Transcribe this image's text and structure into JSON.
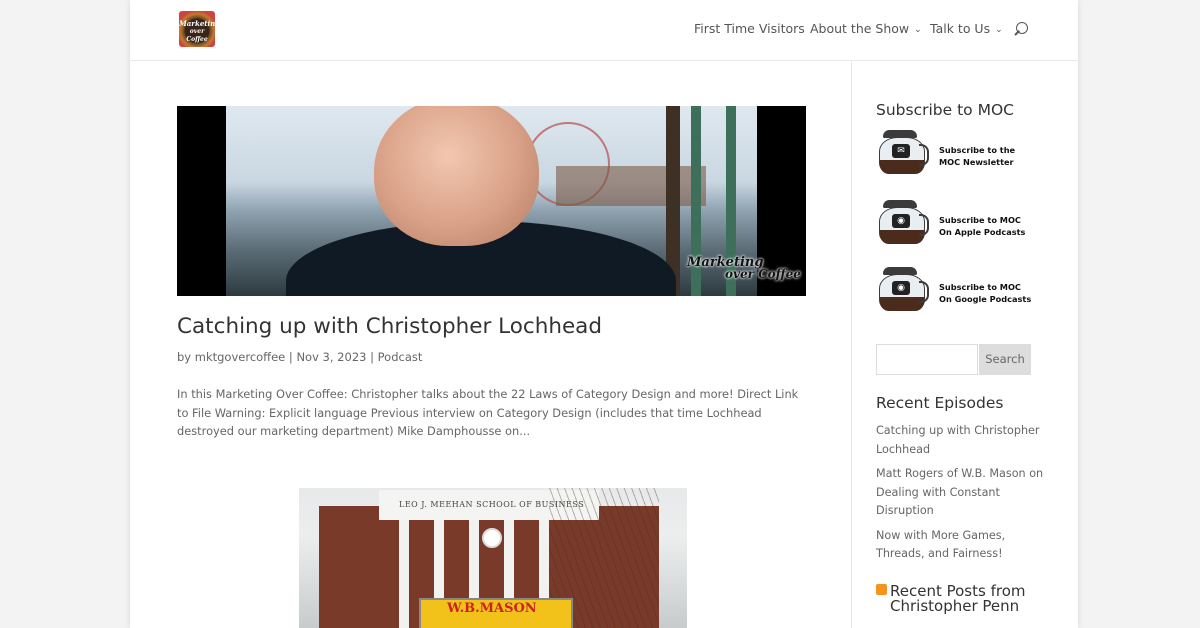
{
  "header": {
    "logo_text_1": "Marketing",
    "logo_text_2": "over Coffee",
    "nav": [
      {
        "label": "First Time Visitors"
      },
      {
        "label": "About the Show"
      },
      {
        "label": "Talk to Us"
      }
    ],
    "chevron": "⌄"
  },
  "post": {
    "hero_brand_1": "Marketing",
    "hero_brand_2": "over Coffee",
    "title": "Catching up with Christopher Lochhead",
    "meta_by": "by",
    "author": "mktgovercoffee",
    "sep": "|",
    "date": "Nov 3, 2023",
    "category": "Podcast",
    "excerpt": "In this Marketing Over Coffee: Christopher talks about the 22 Laws of Category Design and more! Direct Link to File Warning: Explicit language Previous interview on Category Design (includes that time Lochhead destroyed our marketing department) Mike Damphousse on..."
  },
  "photo2": {
    "building_sign": "LEO J. MEEHAN SCHOOL OF BUSINESS",
    "billboard_text": "W.B.MASON"
  },
  "sidebar": {
    "subscribe_heading": "Subscribe to MOC",
    "subscribe_items": [
      {
        "line1": "Subscribe to the",
        "line2": "MOC Newsletter",
        "icon": "✉"
      },
      {
        "line1": "Subscribe to MOC",
        "line2": "On Apple Podcasts",
        "icon": "◉"
      },
      {
        "line1": "Subscribe to MOC",
        "line2": "On Google Podcasts",
        "icon": "◉"
      }
    ],
    "search_placeholder": "",
    "search_button": "Search",
    "recent_heading": "Recent Episodes",
    "recent": [
      "Catching up with Christopher Lochhead",
      "Matt Rogers of W.B. Mason on Dealing with Constant Disruption",
      "Now with More Games, Threads, and Fairness!"
    ],
    "rss_heading": "Recent Posts from Christopher Penn"
  },
  "colors": {
    "background": "#f3f3f3",
    "text": "#666666",
    "heading": "#333333",
    "rss": "#f3941c"
  }
}
